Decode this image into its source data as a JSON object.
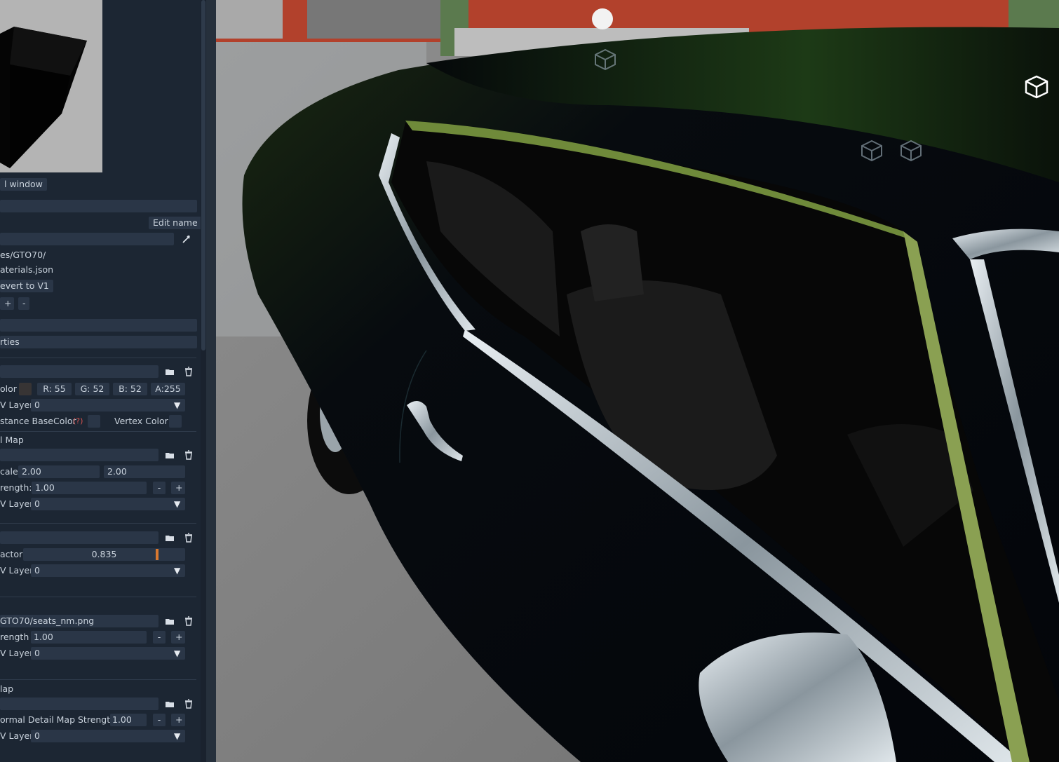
{
  "panel": {
    "preview_window_label": "l window",
    "edit_name_label": "Edit name",
    "path_line": "es/GTO70/",
    "file_line": "aterials.json",
    "revert_label": "evert to V1",
    "plus": "+",
    "minus": "-",
    "properties_header": "rties",
    "base": {
      "color_label": "olor",
      "r": "R: 55",
      "g": "G: 52",
      "b": "B: 52",
      "a": "A:255",
      "uv_label": "V Layer",
      "uv_value": "0",
      "instance_label": "stance BaseColor",
      "help_mark": "(?)",
      "vertex_label": "Vertex Color"
    },
    "detail": {
      "header": "l Map",
      "scale_label": "cale:",
      "scale_x": "2.00",
      "scale_y": "2.00",
      "strength_label": "rength:",
      "strength_value": "1.00",
      "uv_label": "V Layer",
      "uv_value": "0"
    },
    "factor": {
      "label": "actor",
      "value": "0.835",
      "fraction": 0.835,
      "uv_label": "V Layer",
      "uv_value": "0"
    },
    "normal": {
      "file": "GTO70/seats_nm.png",
      "strength_label": "rength",
      "strength_value": "1.00",
      "uv_label": "V Layer",
      "uv_value": "0"
    },
    "normal_detail": {
      "header": "lap",
      "strength_label": "ormal Detail Map Strength",
      "strength_value": "1.00",
      "uv_label": "V Layer",
      "uv_value": "0"
    }
  },
  "colors": {
    "panel_bg": "#1c2633",
    "field_bg": "#2a3647",
    "base_swatch": "#373434",
    "factor_marker": "#d9782f"
  },
  "icons": [
    "folder-icon",
    "trash-icon",
    "eyedropper-icon",
    "dropdown-arrow-icon",
    "object-cube-icon",
    "light-dot-icon"
  ]
}
